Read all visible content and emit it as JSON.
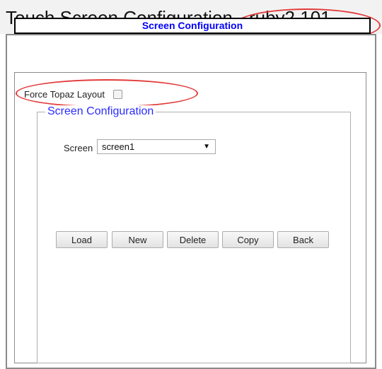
{
  "page": {
    "title": "Touch Screen Configuration - ruby2 101"
  },
  "header": {
    "label": "Screen Configuration"
  },
  "force_topaz": {
    "label": "Force Topaz Layout",
    "checked": false
  },
  "panel": {
    "legend": "Screen Configuration",
    "screen_label": "Screen",
    "screen_select": {
      "value": "screen1",
      "arrow": "▼"
    }
  },
  "buttons": {
    "load": "Load",
    "new": "New",
    "delete": "Delete",
    "copy": "Copy",
    "back": "Back"
  },
  "colors": {
    "accent_text": "#0000ff",
    "legend_text": "#2b2bff",
    "annotation": "#e23a3a"
  }
}
